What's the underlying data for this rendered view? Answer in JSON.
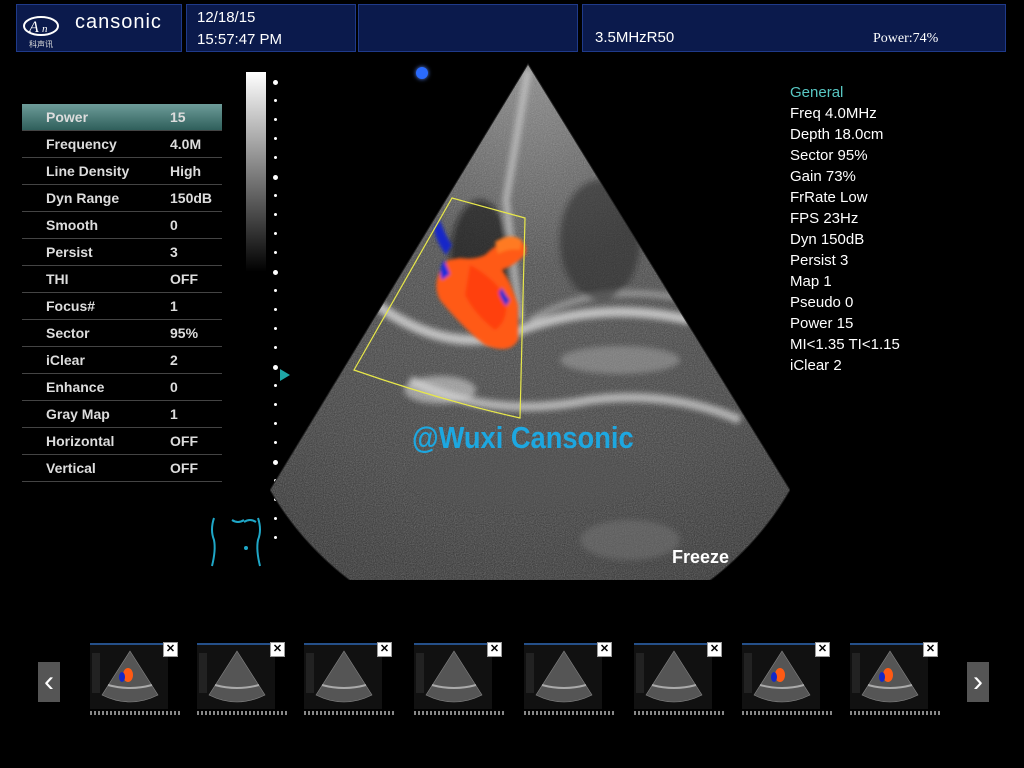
{
  "header": {
    "brand": "cansonic",
    "brand_sub": "科声讯",
    "date": "12/18/15",
    "time": "15:57:47 PM",
    "probe": "3.5MHzR50",
    "power": "Power:74%"
  },
  "params": [
    {
      "name": "Power",
      "value": "15",
      "active": true
    },
    {
      "name": "Frequency",
      "value": "4.0M"
    },
    {
      "name": "Line Density",
      "value": "High"
    },
    {
      "name": "Dyn Range",
      "value": "150dB"
    },
    {
      "name": "Smooth",
      "value": "0"
    },
    {
      "name": "Persist",
      "value": "3"
    },
    {
      "name": "THI",
      "value": "OFF"
    },
    {
      "name": "Focus#",
      "value": "1"
    },
    {
      "name": "Sector",
      "value": "95%"
    },
    {
      "name": "iClear",
      "value": "2"
    },
    {
      "name": "Enhance",
      "value": "0"
    },
    {
      "name": "Gray Map",
      "value": "1"
    },
    {
      "name": "Horizontal",
      "value": "OFF"
    },
    {
      "name": "Vertical",
      "value": "OFF"
    }
  ],
  "info": {
    "header": "General",
    "lines": [
      "Freq 4.0MHz",
      "Depth 18.0cm",
      "Sector 95%",
      "Gain 73%",
      "FrRate Low",
      "FPS 23Hz",
      "Dyn 150dB",
      "Persist 3",
      "Map 1",
      "Pseudo 0",
      "Power 15",
      "MI<1.35  TI<1.15",
      "iClear 2"
    ]
  },
  "watermark": "@Wuxi Cansonic",
  "status": "Freeze",
  "thumbnails": {
    "count": 8,
    "close_symbol": "✕",
    "prev_symbol": "‹",
    "next_symbol": "›"
  },
  "colors": {
    "accent_teal": "#58c7c3",
    "active_row": "#4f807c",
    "watermark": "#1da7e0",
    "panel_bg": "#0b1a4c",
    "doppler_red": "#ff5a14",
    "doppler_blue": "#1428c8",
    "roi_box": "#e8e84a"
  },
  "icons": [
    "brand-logo-icon",
    "orientation-dot-icon",
    "focus-marker-icon",
    "body-mark-icon",
    "close-icon",
    "arrow-left-icon",
    "arrow-right-icon"
  ]
}
